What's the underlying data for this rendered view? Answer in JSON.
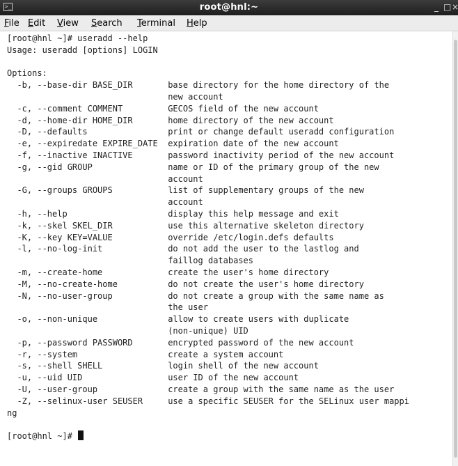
{
  "window": {
    "title": "root@hnl:~",
    "app_icon": "terminal-icon",
    "controls": {
      "minimize": "_",
      "maximize": "□",
      "close": "×"
    }
  },
  "menubar": {
    "items": [
      {
        "first": "F",
        "rest": "ile"
      },
      {
        "first": "E",
        "rest": "dit"
      },
      {
        "first": "V",
        "rest": "iew"
      },
      {
        "first": "S",
        "rest": "earch"
      },
      {
        "first": "T",
        "rest": "erminal"
      },
      {
        "first": "H",
        "rest": "elp"
      }
    ]
  },
  "terminal": {
    "lines": [
      "[root@hnl ~]# useradd --help",
      "Usage: useradd [options] LOGIN",
      "",
      "Options:",
      "  -b, --base-dir BASE_DIR       base directory for the home directory of the",
      "                                new account",
      "  -c, --comment COMMENT         GECOS field of the new account",
      "  -d, --home-dir HOME_DIR       home directory of the new account",
      "  -D, --defaults                print or change default useradd configuration",
      "  -e, --expiredate EXPIRE_DATE  expiration date of the new account",
      "  -f, --inactive INACTIVE       password inactivity period of the new account",
      "  -g, --gid GROUP               name or ID of the primary group of the new",
      "                                account",
      "  -G, --groups GROUPS           list of supplementary groups of the new",
      "                                account",
      "  -h, --help                    display this help message and exit",
      "  -k, --skel SKEL_DIR           use this alternative skeleton directory",
      "  -K, --key KEY=VALUE           override /etc/login.defs defaults",
      "  -l, --no-log-init             do not add the user to the lastlog and",
      "                                faillog databases",
      "  -m, --create-home             create the user's home directory",
      "  -M, --no-create-home          do not create the user's home directory",
      "  -N, --no-user-group           do not create a group with the same name as",
      "                                the user",
      "  -o, --non-unique              allow to create users with duplicate",
      "                                (non-unique) UID",
      "  -p, --password PASSWORD       encrypted password of the new account",
      "  -r, --system                  create a system account",
      "  -s, --shell SHELL             login shell of the new account",
      "  -u, --uid UID                 user ID of the new account",
      "  -U, --user-group              create a group with the same name as the user",
      "  -Z, --selinux-user SEUSER     use a specific SEUSER for the SELinux user mappi",
      "ng",
      ""
    ],
    "prompt": "[root@hnl ~]# "
  }
}
